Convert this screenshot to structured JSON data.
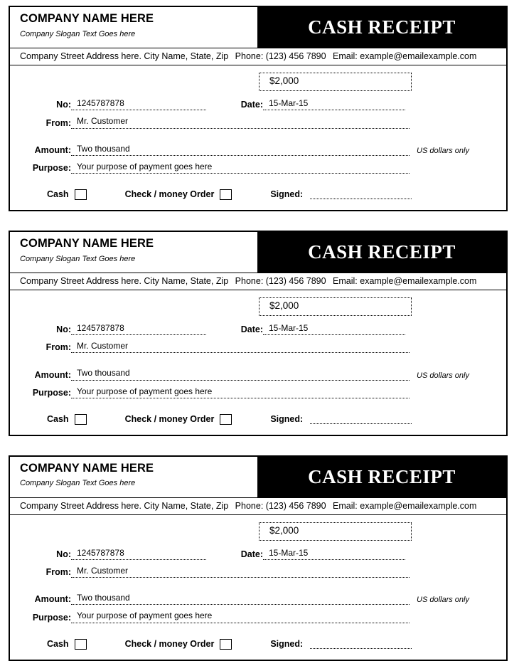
{
  "receipt": {
    "company_name": "COMPANY NAME HERE",
    "company_slogan": "Company Slogan Text Goes here",
    "title": "CASH RECEIPT",
    "contact": {
      "address": "Company Street Address here. City Name, State, Zip",
      "phone": "Phone: (123) 456 7890",
      "email": "Email: example@emailexample.com"
    },
    "amount_box_value": "$2,000",
    "fields": {
      "no_label": "No:",
      "no_value": "1245787878",
      "date_label": "Date:",
      "date_value": "15-Mar-15",
      "from_label": "From:",
      "from_value": "Mr. Customer",
      "amount_label": "Amount:",
      "amount_value": "Two thousand",
      "currency_note": "US dollars only",
      "purpose_label": "Purpose:",
      "purpose_value": "Your purpose of payment goes here"
    },
    "payment": {
      "cash_label": "Cash",
      "check_label": "Check / money Order",
      "signed_label": "Signed:",
      "signed_value": ""
    }
  },
  "colors": {
    "ink": "#000000",
    "paper": "#ffffff",
    "title_bar_bg": "#000000",
    "title_bar_fg": "#ffffff"
  },
  "copies": 3
}
